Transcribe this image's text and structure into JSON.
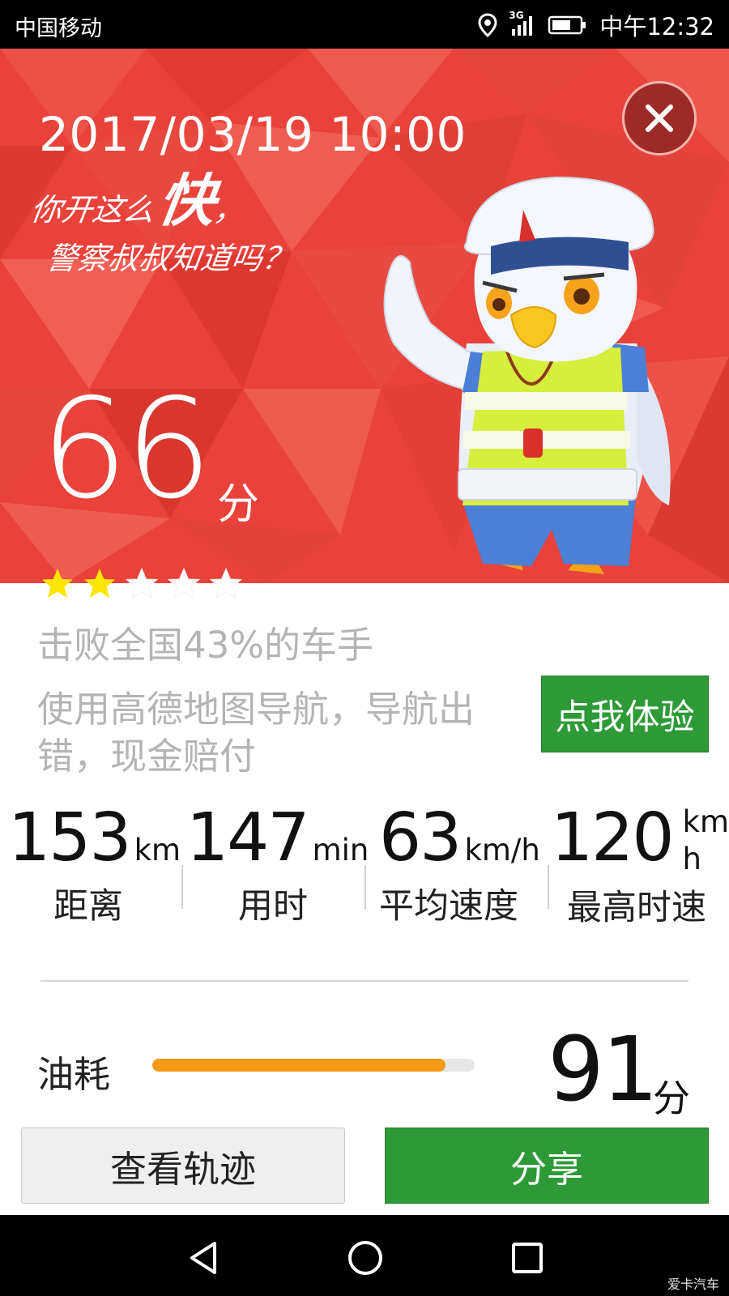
{
  "status_bar": {
    "carrier": "中国移动",
    "network": "3G",
    "time": "中午12:32"
  },
  "hero": {
    "datetime": "2017/03/19 10:00",
    "slogan_part1": "你开这么",
    "slogan_big": "快",
    "slogan_part2": "，",
    "slogan_line2": "警察叔叔知道吗？",
    "score": "66",
    "score_unit": "分",
    "stars_filled": 2,
    "stars_total": 5,
    "close_icon": "close-icon",
    "mascot": "eagle-police-mascot"
  },
  "beat_text": "击败全国43%的车手",
  "promo": {
    "text": "使用高德地图导航，导航出错，现金赔付",
    "button_label": "点我体验"
  },
  "stats": [
    {
      "value": "153",
      "unit": "km",
      "label": "距离"
    },
    {
      "value": "147",
      "unit": "min",
      "label": "用时"
    },
    {
      "value": "63",
      "unit": "km/h",
      "label": "平均速度"
    },
    {
      "value": "120",
      "unit": "km/h",
      "label": "最高时速"
    }
  ],
  "fuel": {
    "label": "油耗",
    "progress": 0.91,
    "score": "91",
    "score_unit": "分"
  },
  "buttons": {
    "track": "查看轨迹",
    "share": "分享"
  },
  "nav_bar": {
    "back_icon": "back-icon",
    "home_icon": "home-icon",
    "recent_icon": "recent-apps-icon"
  },
  "watermark": "爱卡汽车",
  "colors": {
    "hero_red": "#e8423a",
    "accent_green": "#2e9a37",
    "fuel_orange": "#f49a16",
    "star_yellow": "#ffe600"
  }
}
